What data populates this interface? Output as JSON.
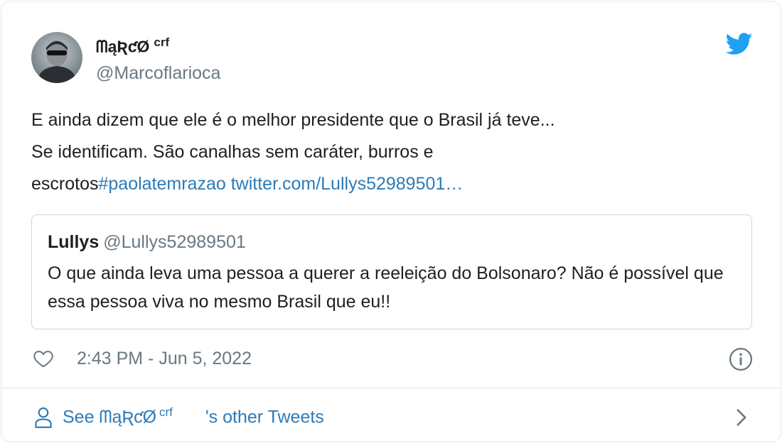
{
  "author": {
    "display_name": "ᗰąƦƈØ",
    "display_suffix": "crf",
    "handle": "@Marcoflarioca"
  },
  "tweet": {
    "line1": "E ainda dizem que ele é o melhor presidente que o Brasil já teve...",
    "line2": "Se identificam. São canalhas  sem caráter, burros e",
    "line3_text": "escrotos",
    "hashtag": "#paolatemrazao",
    "link": "twitter.com/Lullys52989501…"
  },
  "quoted": {
    "name": "Lullys",
    "handle": "@Lullys52989501",
    "text": "O que ainda leva uma pessoa a querer a reeleição do Bolsonaro? Não é possível que essa pessoa viva no mesmo Brasil que eu!!"
  },
  "meta": {
    "timestamp": "2:43 PM - Jun 5, 2022"
  },
  "footer": {
    "prefix": "See ",
    "name": "ᗰąƦƈØ",
    "suffix": "crf",
    "rest": "'s other Tweets"
  },
  "icons": {
    "brand": "twitter-bird-icon",
    "like": "heart-icon",
    "info": "info-icon",
    "profile": "person-icon",
    "more": "chevron-right-icon"
  },
  "colors": {
    "link": "#2b7bb9",
    "twitter_blue": "#1da1f2",
    "secondary_text": "#697882",
    "border": "#e1e8ed"
  }
}
